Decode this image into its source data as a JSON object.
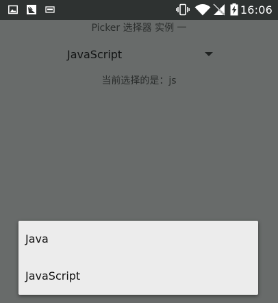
{
  "status_bar": {
    "time": "16:06",
    "left_icons": [
      "gallery-icon",
      "bird-app-icon",
      "ftp-icon"
    ],
    "right_icons": [
      "vibrate-icon",
      "wifi-icon",
      "no-signal-icon",
      "battery-charging-icon"
    ]
  },
  "page": {
    "title": "Picker 选择器 实例 一",
    "spinner": {
      "selected_label": "JavaScript",
      "arrow_icon": "dropdown-arrow-icon"
    },
    "current_selection": "当前选择的是：js"
  },
  "dropdown": {
    "options": [
      {
        "label": "Java"
      },
      {
        "label": "JavaScript"
      }
    ]
  },
  "colors": {
    "status_bar_bg": "#2e3231",
    "dimmed_background": "#686b6a",
    "popup_bg": "#ececec"
  }
}
